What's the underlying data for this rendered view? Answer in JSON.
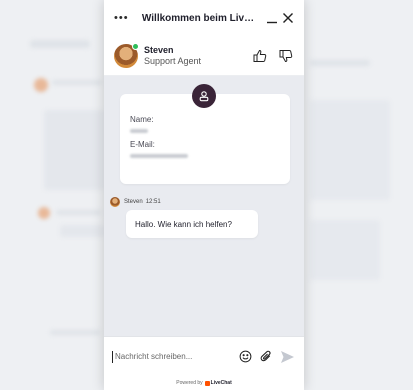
{
  "window": {
    "title": "Willkommen beim Liv…"
  },
  "agent": {
    "name": "Steven",
    "role": "Support Agent"
  },
  "form": {
    "name_label": "Name:",
    "email_label": "E-Mail:"
  },
  "message": {
    "author": "Steven",
    "time": "12:51",
    "text": "Hallo. Wie kann ich helfen?"
  },
  "composer": {
    "placeholder": "Nachricht schreiben..."
  },
  "footer": {
    "powered_by": "Powered by",
    "brand": "LiveChat"
  },
  "colors": {
    "conversation_bg": "#e9ebf0",
    "form_icon_bg": "#3a2438",
    "online": "#2dbd5a",
    "brand": "#ff5100"
  }
}
